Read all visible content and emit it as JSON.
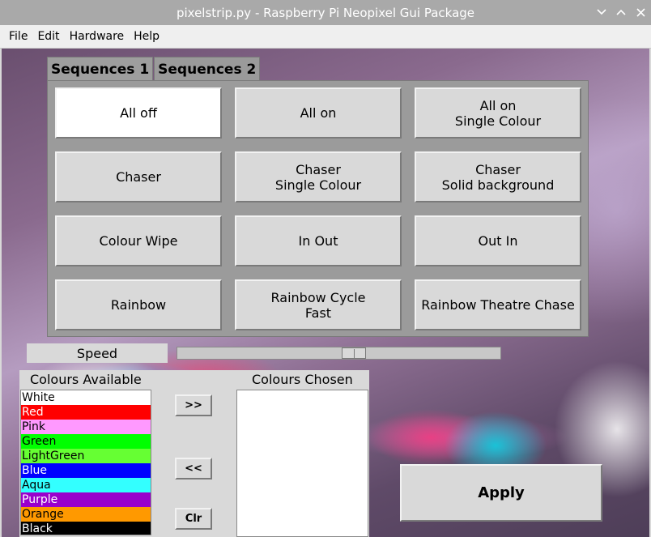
{
  "window": {
    "title": "pixelstrip.py - Raspberry Pi Neopixel Gui Package",
    "controls": [
      "chevron-down-icon",
      "chevron-up-icon",
      "close-icon"
    ]
  },
  "menu": [
    "File",
    "Edit",
    "Hardware",
    "Help"
  ],
  "tabs": [
    {
      "label": "Sequences 1",
      "active": true
    },
    {
      "label": "Sequences 2",
      "active": false
    }
  ],
  "sequence_buttons": [
    {
      "line1": "All off",
      "line2": "",
      "highlighted": true
    },
    {
      "line1": "All on",
      "line2": ""
    },
    {
      "line1": "All on",
      "line2": "Single Colour"
    },
    {
      "line1": "Chaser",
      "line2": ""
    },
    {
      "line1": "Chaser",
      "line2": "Single Colour"
    },
    {
      "line1": "Chaser",
      "line2": "Solid background"
    },
    {
      "line1": "Colour Wipe",
      "line2": ""
    },
    {
      "line1": "In Out",
      "line2": ""
    },
    {
      "line1": "Out In",
      "line2": ""
    },
    {
      "line1": "Rainbow",
      "line2": ""
    },
    {
      "line1": "Rainbow Cycle",
      "line2": "Fast"
    },
    {
      "line1": "Rainbow Theatre Chase",
      "line2": ""
    }
  ],
  "speed": {
    "label": "Speed",
    "level": 0.55
  },
  "colours": {
    "available_label": "Colours Available",
    "chosen_label": "Colours Chosen",
    "available": [
      {
        "name": "White",
        "bg": "#ffffff",
        "fg": "#000000"
      },
      {
        "name": "Red",
        "bg": "#ff0000",
        "fg": "#ffffff"
      },
      {
        "name": "Pink",
        "bg": "#ff99ff",
        "fg": "#000000"
      },
      {
        "name": "Green",
        "bg": "#00ff00",
        "fg": "#000000"
      },
      {
        "name": "LightGreen",
        "bg": "#66ff33",
        "fg": "#000000"
      },
      {
        "name": "Blue",
        "bg": "#0000ff",
        "fg": "#ffffff"
      },
      {
        "name": "Aqua",
        "bg": "#33ffff",
        "fg": "#000000"
      },
      {
        "name": "Purple",
        "bg": "#9900cc",
        "fg": "#ffffff"
      },
      {
        "name": "Orange",
        "bg": "#ff9900",
        "fg": "#000000"
      },
      {
        "name": "Black",
        "bg": "#000000",
        "fg": "#ffffff"
      }
    ],
    "chosen": [],
    "add_label": ">>",
    "remove_label": "<<",
    "clear_label": "Clr"
  },
  "apply_label": "Apply"
}
